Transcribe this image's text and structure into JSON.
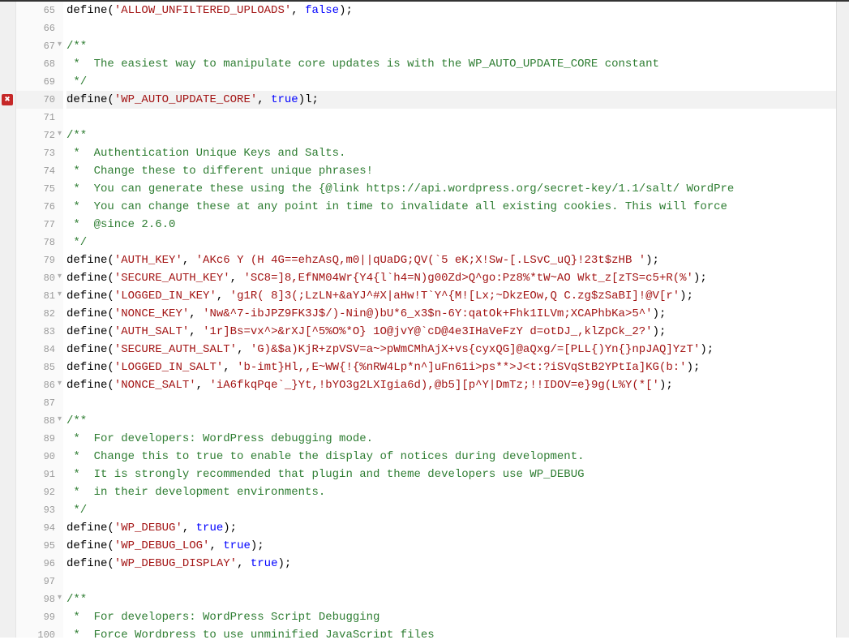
{
  "editor": {
    "lines": [
      {
        "n": 65,
        "tokens": [
          [
            "fn",
            "define"
          ],
          [
            "punc",
            "("
          ],
          [
            "str",
            "'ALLOW_UNFILTERED_UPLOADS'"
          ],
          [
            "punc",
            ", "
          ],
          [
            "const",
            "false"
          ],
          [
            "punc",
            ");"
          ]
        ]
      },
      {
        "n": 66,
        "tokens": []
      },
      {
        "n": 67,
        "fold": true,
        "tokens": [
          [
            "comm",
            "/**"
          ]
        ]
      },
      {
        "n": 68,
        "tokens": [
          [
            "comm",
            " *  The easiest way to manipulate core updates is with the WP_AUTO_UPDATE_CORE constant"
          ]
        ]
      },
      {
        "n": 69,
        "tokens": [
          [
            "comm",
            " */"
          ]
        ]
      },
      {
        "n": 70,
        "error": true,
        "tokens": [
          [
            "fn",
            "define"
          ],
          [
            "punc",
            "("
          ],
          [
            "str",
            "'WP_AUTO_UPDATE_CORE'"
          ],
          [
            "punc",
            ", "
          ],
          [
            "const",
            "true"
          ],
          [
            "punc",
            ")"
          ],
          [
            "plain",
            "l"
          ],
          [
            "punc",
            ";"
          ]
        ]
      },
      {
        "n": 71,
        "tokens": []
      },
      {
        "n": 72,
        "fold": true,
        "tokens": [
          [
            "comm",
            "/**"
          ]
        ]
      },
      {
        "n": 73,
        "tokens": [
          [
            "comm",
            " *  Authentication Unique Keys and Salts."
          ]
        ]
      },
      {
        "n": 74,
        "tokens": [
          [
            "comm",
            " *  Change these to different unique phrases!"
          ]
        ]
      },
      {
        "n": 75,
        "tokens": [
          [
            "comm",
            " *  You can generate these using the {@link https://api.wordpress.org/secret-key/1.1/salt/ WordPre"
          ]
        ]
      },
      {
        "n": 76,
        "tokens": [
          [
            "comm",
            " *  You can change these at any point in time to invalidate all existing cookies. This will force "
          ]
        ]
      },
      {
        "n": 77,
        "tokens": [
          [
            "comm",
            " *  @since 2.6.0"
          ]
        ]
      },
      {
        "n": 78,
        "tokens": [
          [
            "comm",
            " */"
          ]
        ]
      },
      {
        "n": 79,
        "tokens": [
          [
            "fn",
            "define"
          ],
          [
            "punc",
            "("
          ],
          [
            "str",
            "'AUTH_KEY'"
          ],
          [
            "punc",
            ", "
          ],
          [
            "str",
            "'AKc6 Y (H 4G==ehzAsQ,m0||qUaDG;QV(`5 eK;X!Sw-[.LSvC_uQ}!23t$zHB '"
          ],
          [
            "punc",
            ");"
          ]
        ]
      },
      {
        "n": 80,
        "fold": true,
        "tokens": [
          [
            "fn",
            "define"
          ],
          [
            "punc",
            "("
          ],
          [
            "str",
            "'SECURE_AUTH_KEY'"
          ],
          [
            "punc",
            ", "
          ],
          [
            "str",
            "'SC8=]8,EfNM04Wr{Y4{l`h4=N)g00Zd>Q^go:Pz8%*tW~AO Wkt_z[zTS=c5+R(%'"
          ],
          [
            "punc",
            ");"
          ]
        ]
      },
      {
        "n": 81,
        "fold": true,
        "tokens": [
          [
            "fn",
            "define"
          ],
          [
            "punc",
            "("
          ],
          [
            "str",
            "'LOGGED_IN_KEY'"
          ],
          [
            "punc",
            ", "
          ],
          [
            "str",
            "'g1R( 8]3(;LzLN+&aYJ^#X|aHw!T`Y^{M![Lx;~DkzEOw,Q C.zg$zSaBI]!@V[r'"
          ],
          [
            "punc",
            ");"
          ]
        ]
      },
      {
        "n": 82,
        "tokens": [
          [
            "fn",
            "define"
          ],
          [
            "punc",
            "("
          ],
          [
            "str",
            "'NONCE_KEY'"
          ],
          [
            "punc",
            ", "
          ],
          [
            "str",
            "'Nw&^7-ibJPZ9FK3J$/)-Nin@)bU*6_x3$n-6Y:qatOk+Fhk1ILVm;XCAPhbKa>5^'"
          ],
          [
            "punc",
            ");"
          ]
        ]
      },
      {
        "n": 83,
        "tokens": [
          [
            "fn",
            "define"
          ],
          [
            "punc",
            "("
          ],
          [
            "str",
            "'AUTH_SALT'"
          ],
          [
            "punc",
            ", "
          ],
          [
            "str",
            "'1r]Bs=vx^>&rXJ[^5%O%*O} 1O@jvY@`cD@4e3IHaVeFzY d=otDJ_,klZpCk_2?'"
          ],
          [
            "punc",
            ");"
          ]
        ]
      },
      {
        "n": 84,
        "tokens": [
          [
            "fn",
            "define"
          ],
          [
            "punc",
            "("
          ],
          [
            "str",
            "'SECURE_AUTH_SALT'"
          ],
          [
            "punc",
            ", "
          ],
          [
            "str",
            "'G)&$a)KjR+zpVSV=a~>pWmCMhAjX+vs{cyxQG]@aQxg/=[PLL{)Yn{}npJAQ]YzT'"
          ],
          [
            "punc",
            ");"
          ]
        ]
      },
      {
        "n": 85,
        "tokens": [
          [
            "fn",
            "define"
          ],
          [
            "punc",
            "("
          ],
          [
            "str",
            "'LOGGED_IN_SALT'"
          ],
          [
            "punc",
            ", "
          ],
          [
            "str",
            "'b-imt}Hl,,E~WW{!{%nRW4Lp*n^]uFn61i>ps**>J<t:?iSVqStB2YPtIa]KG(b:'"
          ],
          [
            "punc",
            ");"
          ]
        ]
      },
      {
        "n": 86,
        "fold": true,
        "tokens": [
          [
            "fn",
            "define"
          ],
          [
            "punc",
            "("
          ],
          [
            "str",
            "'NONCE_SALT'"
          ],
          [
            "punc",
            ", "
          ],
          [
            "str",
            "'iA6fkqPqe`_}Yt,!bYO3g2LXIgia6d),@b5][p^Y|DmTz;!!IDOV=e}9g(L%Y(*['"
          ],
          [
            "punc",
            ");"
          ]
        ]
      },
      {
        "n": 87,
        "tokens": []
      },
      {
        "n": 88,
        "fold": true,
        "tokens": [
          [
            "comm",
            "/**"
          ]
        ]
      },
      {
        "n": 89,
        "tokens": [
          [
            "comm",
            " *  For developers: WordPress debugging mode."
          ]
        ]
      },
      {
        "n": 90,
        "tokens": [
          [
            "comm",
            " *  Change this to true to enable the display of notices during development."
          ]
        ]
      },
      {
        "n": 91,
        "tokens": [
          [
            "comm",
            " *  It is strongly recommended that plugin and theme developers use WP_DEBUG"
          ]
        ]
      },
      {
        "n": 92,
        "tokens": [
          [
            "comm",
            " *  in their development environments."
          ]
        ]
      },
      {
        "n": 93,
        "tokens": [
          [
            "comm",
            " */"
          ]
        ]
      },
      {
        "n": 94,
        "tokens": [
          [
            "fn",
            "define"
          ],
          [
            "punc",
            "("
          ],
          [
            "str",
            "'WP_DEBUG'"
          ],
          [
            "punc",
            ", "
          ],
          [
            "const",
            "true"
          ],
          [
            "punc",
            ");"
          ]
        ]
      },
      {
        "n": 95,
        "tokens": [
          [
            "fn",
            "define"
          ],
          [
            "punc",
            "("
          ],
          [
            "str",
            "'WP_DEBUG_LOG'"
          ],
          [
            "punc",
            ", "
          ],
          [
            "const",
            "true"
          ],
          [
            "punc",
            ");"
          ]
        ]
      },
      {
        "n": 96,
        "tokens": [
          [
            "fn",
            "define"
          ],
          [
            "punc",
            "("
          ],
          [
            "str",
            "'WP_DEBUG_DISPLAY'"
          ],
          [
            "punc",
            ", "
          ],
          [
            "const",
            "true"
          ],
          [
            "punc",
            ");"
          ]
        ]
      },
      {
        "n": 97,
        "tokens": []
      },
      {
        "n": 98,
        "fold": true,
        "tokens": [
          [
            "comm",
            "/**"
          ]
        ]
      },
      {
        "n": 99,
        "tokens": [
          [
            "comm",
            " *  For developers: WordPress Script Debugging"
          ]
        ]
      },
      {
        "n": 100,
        "tokens": [
          [
            "comm",
            " *  Force Wordpress to use unminified JavaScript files"
          ]
        ]
      }
    ]
  }
}
